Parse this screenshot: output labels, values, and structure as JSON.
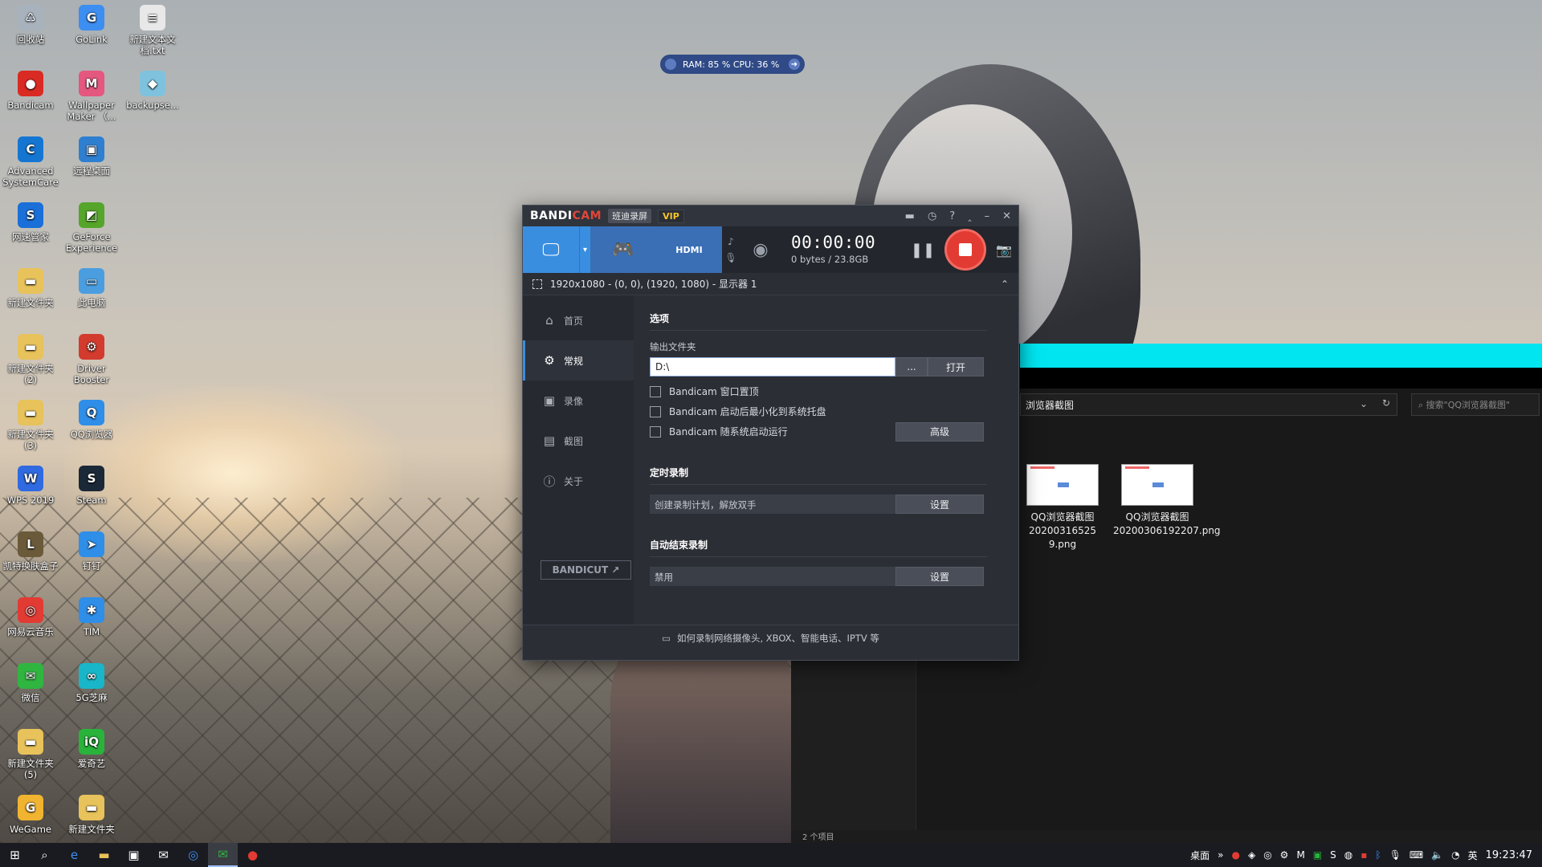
{
  "desktop_icons": [
    {
      "label": "回收站",
      "color": "#a8b2bc",
      "glyph": "♺"
    },
    {
      "label": "GoLink",
      "color": "#3c8ef0",
      "glyph": "G"
    },
    {
      "label": "新建文本文档.txt",
      "color": "#e8e8e8",
      "glyph": "≡"
    },
    {
      "label": "Bandicam",
      "color": "#d92b23",
      "glyph": "●"
    },
    {
      "label": "Wallpaper Maker （...",
      "color": "#e4577e",
      "glyph": "M"
    },
    {
      "label": "backupse...",
      "color": "#7fc2de",
      "glyph": "◆"
    },
    {
      "label": "Advanced SystemCare",
      "color": "#1576d2",
      "glyph": "C"
    },
    {
      "label": "远程桌面",
      "color": "#2f7fd0",
      "glyph": "▣"
    },
    {
      "label": "网速管家",
      "color": "#1a6fd8",
      "glyph": "S"
    },
    {
      "label": "GeForce Experience",
      "color": "#55a52a",
      "glyph": "◩"
    },
    {
      "label": "新建文件夹",
      "color": "#e8c25a",
      "glyph": "▬"
    },
    {
      "label": "此电脑",
      "color": "#4a9ee0",
      "glyph": "▭"
    },
    {
      "label": "新建文件夹 (2)",
      "color": "#e8c25a",
      "glyph": "▬"
    },
    {
      "label": "Driver Booster",
      "color": "#d23b2d",
      "glyph": "⚙"
    },
    {
      "label": "新建文件夹 (3)",
      "color": "#e8c25a",
      "glyph": "▬"
    },
    {
      "label": "QQ浏览器",
      "color": "#2f8ee8",
      "glyph": "Q"
    },
    {
      "label": "WPS 2019",
      "color": "#2f6ae0",
      "glyph": "W"
    },
    {
      "label": "Steam",
      "color": "#1b2838",
      "glyph": "S"
    },
    {
      "label": "凯特换肤盒子",
      "color": "#6a5a3a",
      "glyph": "L"
    },
    {
      "label": "钉钉",
      "color": "#2f8ee8",
      "glyph": "➤"
    },
    {
      "label": "网易云音乐",
      "color": "#e23b33",
      "glyph": "◎"
    },
    {
      "label": "TIM",
      "color": "#2f8ee8",
      "glyph": "✱"
    },
    {
      "label": "微信",
      "color": "#30b540",
      "glyph": "✉"
    },
    {
      "label": "5G芝麻",
      "color": "#18b6c8",
      "glyph": "∞"
    },
    {
      "label": "新建文件夹 (5)",
      "color": "#e8c25a",
      "glyph": "▬"
    },
    {
      "label": "爱奇艺",
      "color": "#29b33b",
      "glyph": "iQ"
    },
    {
      "label": "WeGame",
      "color": "#f0b431",
      "glyph": "G"
    },
    {
      "label": "新建文件夹",
      "color": "#e8c25a",
      "glyph": "▬"
    }
  ],
  "perf_overlay": {
    "text": "RAM: 85 %  CPU: 36 %"
  },
  "explorer": {
    "address": "浏览器截图",
    "search_placeholder": "搜索\"QQ浏览器截图\"",
    "files": [
      {
        "name": "QQ浏览器截图20200316525 9.png"
      },
      {
        "name": "QQ浏览器截图20200306192207.png"
      }
    ],
    "status": "2 个项目"
  },
  "bandicam": {
    "brand_main": "BANDI",
    "brand_accent": "CAM",
    "subtitle": "班迪录屏",
    "vip": "VIP",
    "timer": "00:00:00",
    "size": "0 bytes / 23.8GB",
    "region": "1920x1080 - (0, 0), (1920, 1080) - 显示器 1",
    "nav": [
      {
        "label": "首页",
        "icon": "home-icon"
      },
      {
        "label": "常规",
        "icon": "gear-icon"
      },
      {
        "label": "录像",
        "icon": "video-icon"
      },
      {
        "label": "截图",
        "icon": "image-icon"
      },
      {
        "label": "关于",
        "icon": "info-icon"
      }
    ],
    "bandicut": "BANDICUT ↗",
    "options": {
      "title": "选项",
      "output_label": "输出文件夹",
      "output_value": "D:\\",
      "browse": "...",
      "open": "打开",
      "checkboxes": [
        "Bandicam 窗口置顶",
        "Bandicam 启动后最小化到系统托盘",
        "Bandicam 随系统启动运行"
      ],
      "advanced": "高级"
    },
    "schedule": {
      "title": "定时录制",
      "value": "创建录制计划，解放双手",
      "button": "设置"
    },
    "autostop": {
      "title": "自动结束录制",
      "value": "禁用",
      "button": "设置"
    },
    "footer": "如何录制网络摄像头, XBOX、智能电话、IPTV 等"
  },
  "taskbar": {
    "tray_desktop": "桌面",
    "lang": "英",
    "clock": "19:23:47"
  }
}
